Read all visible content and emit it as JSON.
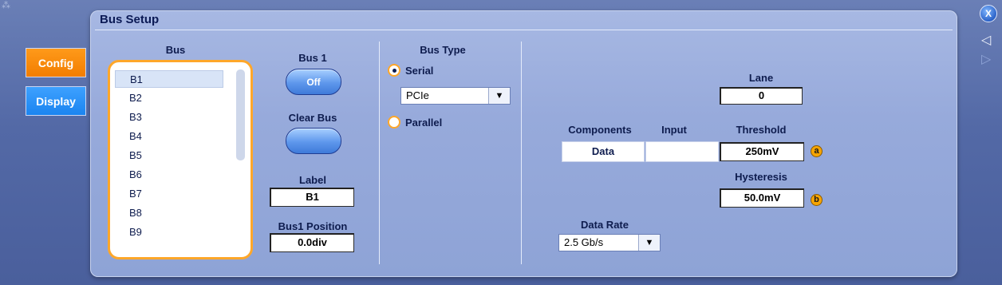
{
  "window": {
    "title": "Bus Setup",
    "corner_glyph": "⁂"
  },
  "tabs": [
    {
      "label": "Config",
      "active": true
    },
    {
      "label": "Display",
      "active": false
    }
  ],
  "bus_list": {
    "header": "Bus",
    "items": [
      "B1",
      "B2",
      "B3",
      "B4",
      "B5",
      "B6",
      "B7",
      "B8",
      "B9"
    ],
    "selected": "B1"
  },
  "bus_toggle": {
    "label": "Bus 1",
    "button": "Off"
  },
  "clear_bus": {
    "label": "Clear Bus"
  },
  "label_field": {
    "label": "Label",
    "value": "B1"
  },
  "position_field": {
    "label": "Bus1 Position",
    "value": "0.0div"
  },
  "bus_type": {
    "header": "Bus Type",
    "serial_label": "Serial",
    "parallel_label": "Parallel",
    "selected": "Serial",
    "protocol": "PCIe",
    "dropdown_icon": "▼"
  },
  "lane": {
    "label": "Lane",
    "value": "0"
  },
  "components": {
    "headers": [
      "Components",
      "Input",
      "Threshold"
    ],
    "row_component": "Data",
    "row_input": "",
    "threshold": "250mV",
    "threshold_badge": "a"
  },
  "hysteresis": {
    "label": "Hysteresis",
    "value": "50.0mV",
    "badge": "b"
  },
  "data_rate": {
    "label": "Data Rate",
    "value": "2.5 Gb/s",
    "dropdown_icon": "▼"
  },
  "controls": {
    "close": "X",
    "prev_icon": "◁",
    "next_icon": "▷"
  },
  "colors": {
    "tab_active": "#f27d00",
    "tab_inactive": "#1b84f0",
    "list_border": "#ffa72a",
    "badge": "#f7a400"
  }
}
